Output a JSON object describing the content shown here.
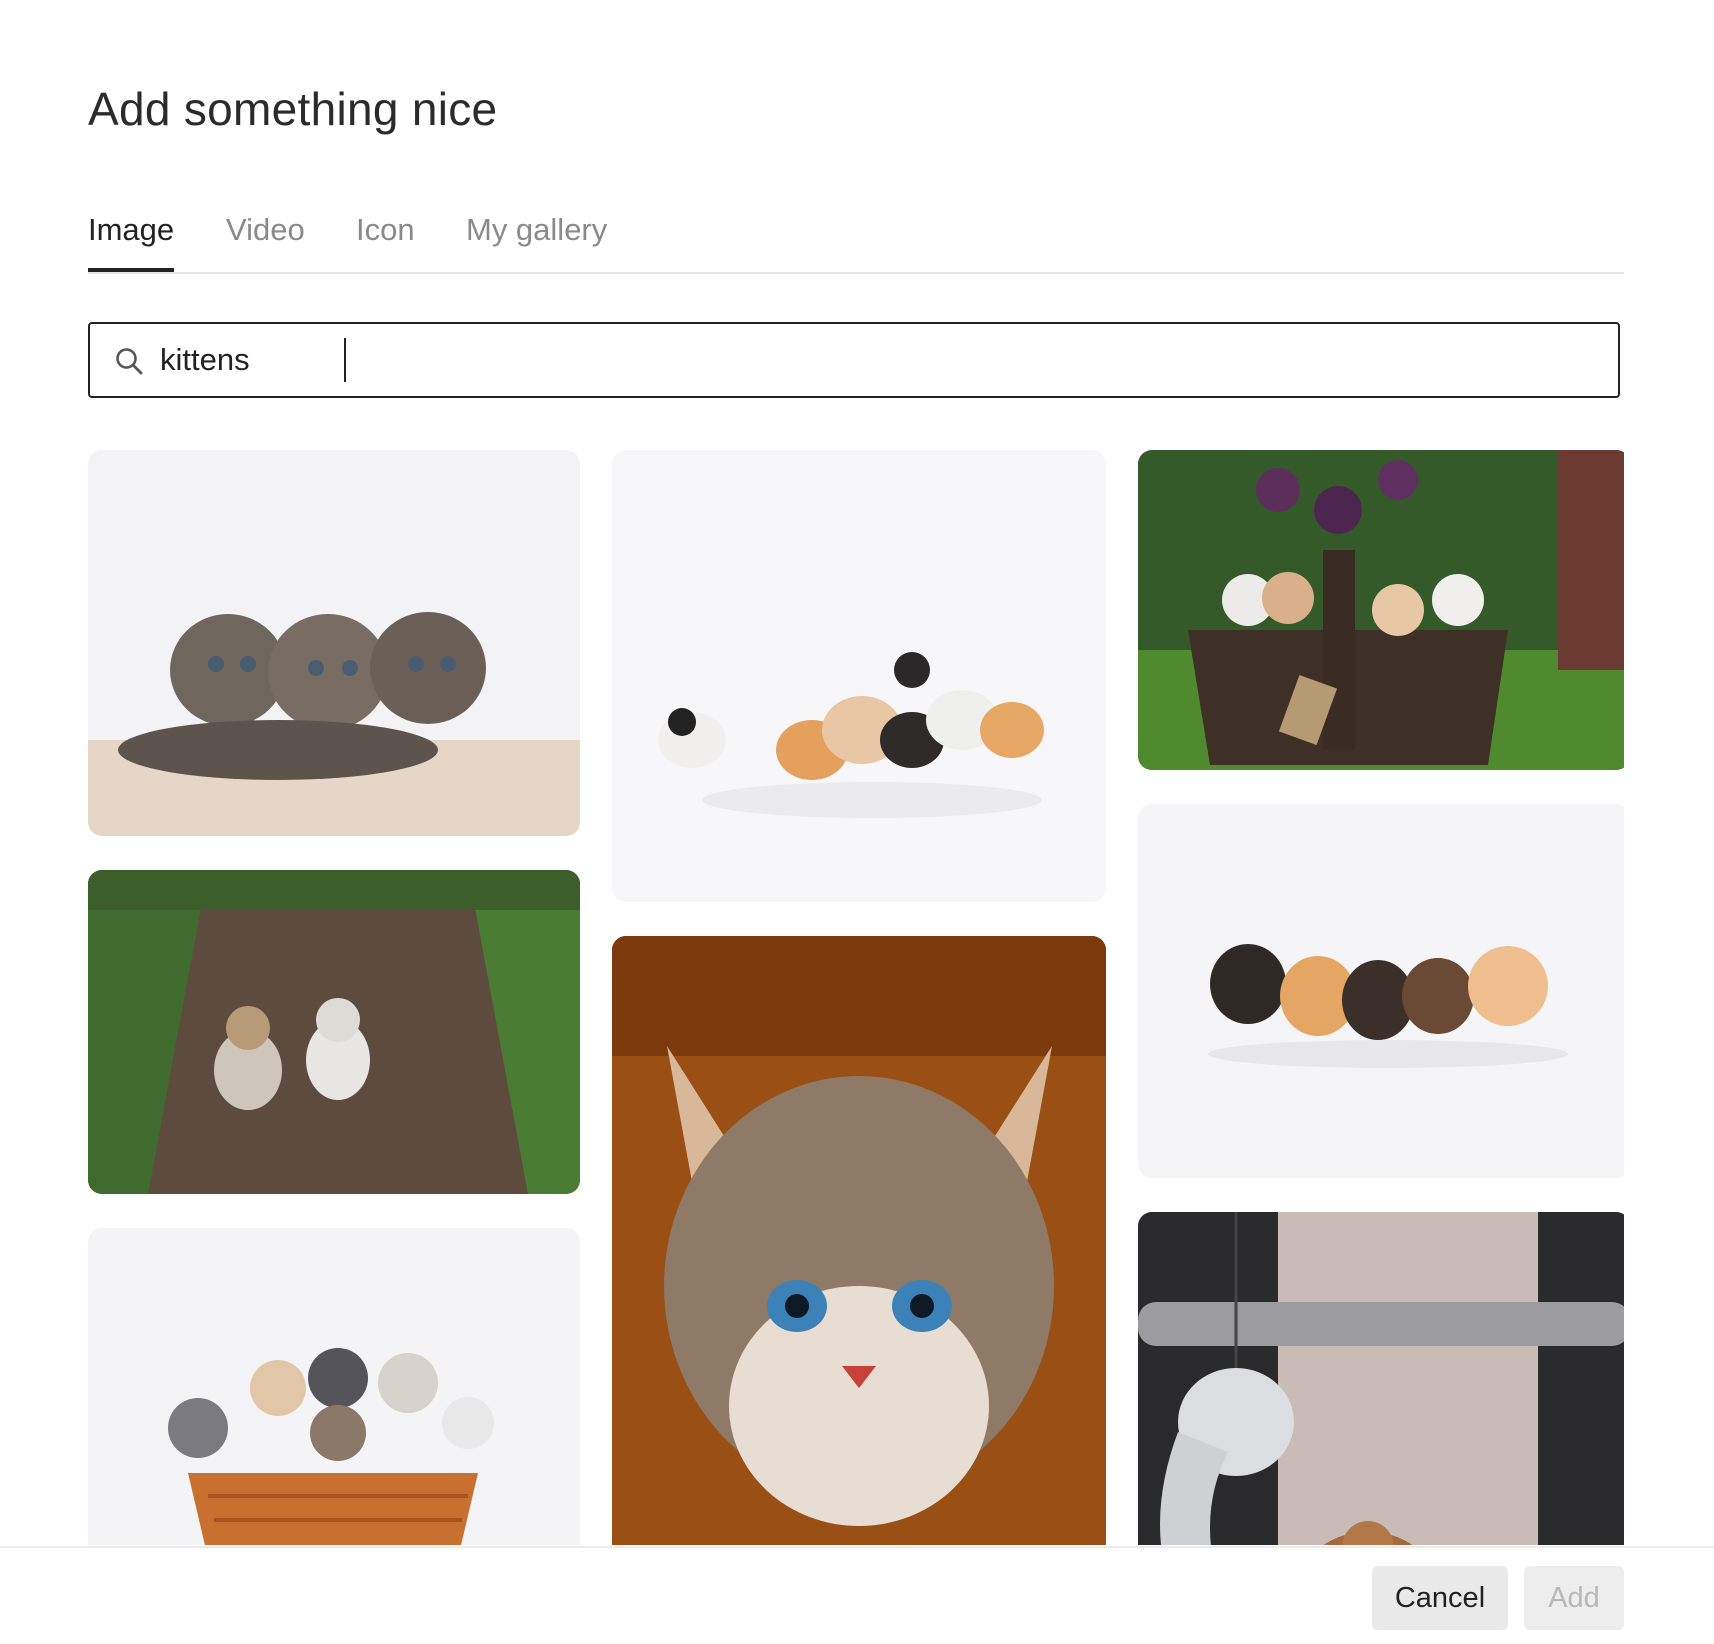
{
  "dialog": {
    "title": "Add something nice",
    "tabs": [
      {
        "label": "Image",
        "active": true
      },
      {
        "label": "Video",
        "active": false
      },
      {
        "label": "Icon",
        "active": false
      },
      {
        "label": "My gallery",
        "active": false
      }
    ],
    "search": {
      "value": "kittens",
      "icon": "search-icon"
    },
    "results": [
      {
        "id": "kittens-three-tabby"
      },
      {
        "id": "kittens-group-white"
      },
      {
        "id": "kittens-basket-garden"
      },
      {
        "id": "kittens-path"
      },
      {
        "id": "kitten-closeup"
      },
      {
        "id": "kittens-row-white"
      },
      {
        "id": "kittens-orange-basket"
      },
      {
        "id": "kitten-cat-tree"
      }
    ],
    "footer": {
      "cancel_label": "Cancel",
      "add_label": "Add"
    }
  },
  "colors": {
    "text": "#222222",
    "muted": "#8a8a8a",
    "divider": "#e6e6e6",
    "button_bg": "#e9e9e9"
  }
}
